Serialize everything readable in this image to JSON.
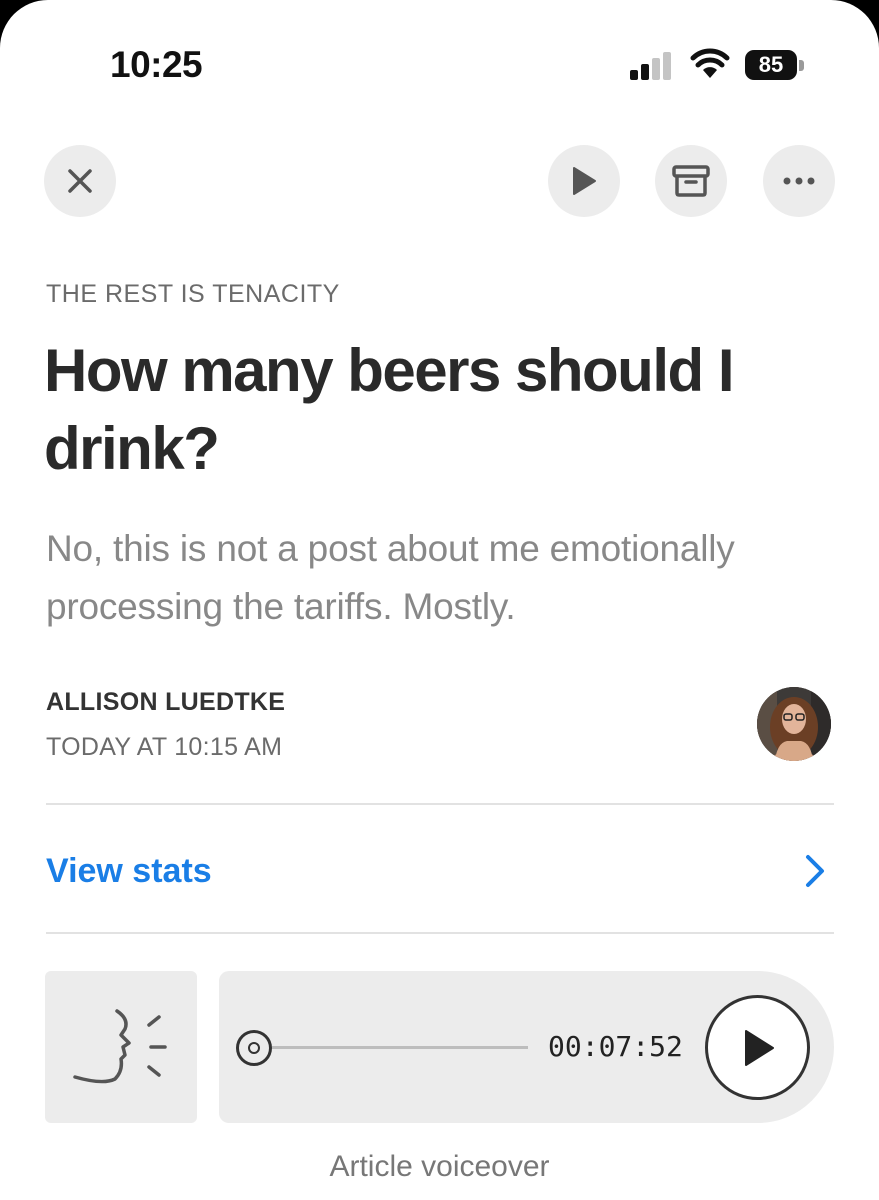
{
  "status_bar": {
    "time": "10:25",
    "battery": "85",
    "icons": [
      "signal-icon",
      "wifi-icon",
      "battery-icon"
    ]
  },
  "toolbar": {
    "close_icon": "close-icon",
    "play_icon": "play-icon",
    "archive_icon": "archive-icon",
    "more_icon": "more-icon"
  },
  "post": {
    "section": "THE REST IS TENACITY",
    "title": "How many beers should I drink?",
    "subtitle": "No, this is not a post about me emotionally processing the tariffs. Mostly.",
    "author": "ALLISON LUEDTKE",
    "date": "TODAY AT 10:15 AM"
  },
  "stats": {
    "label": "View stats",
    "accent": "#1a7ee6"
  },
  "voiceover": {
    "duration": "00:07:52",
    "progress": 0,
    "caption": "Article voiceover"
  }
}
